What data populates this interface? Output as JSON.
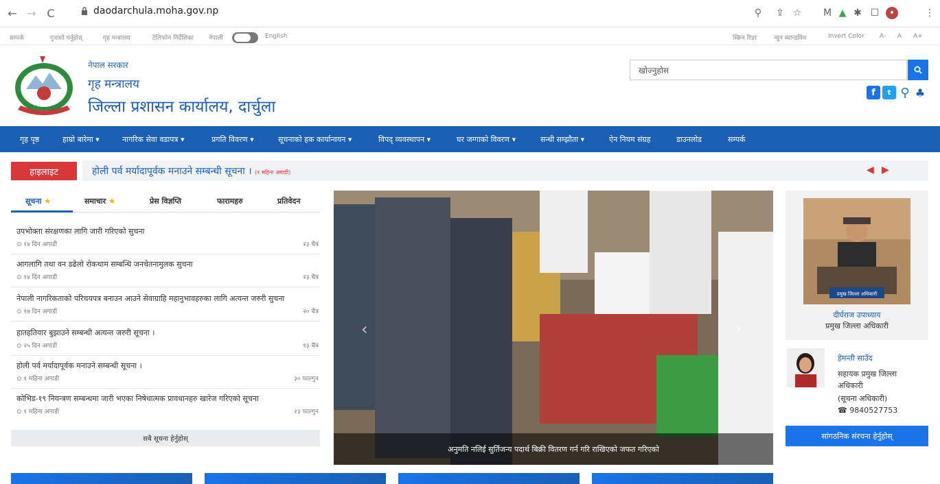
{
  "browser": {
    "url": "daodarchula.moha.gov.np"
  },
  "utility": {
    "left": [
      "सम्पर्क",
      "गुनासो गर्नुहोस्",
      "गृह मन्त्रालय",
      "टेलिफोन निर्देशिका",
      "नेपाली",
      "English"
    ],
    "right": [
      "स्क्रिन रिडर",
      "न्यून ब्यान्डविथ",
      "Invert Color",
      "A-",
      "A",
      "A+"
    ]
  },
  "header": {
    "gov": "नेपाल सरकार",
    "ministry": "गृह मन्त्रालय",
    "office": "जिल्ला प्रशासन कार्यालय, दार्चुला",
    "search_placeholder": "खोज्नुहोस"
  },
  "nav": [
    "गृह पृष्ठ",
    "हाम्रो बारेमा ▾",
    "नागरिक सेवा वडापत्र ▾",
    "प्रगति विवरण ▾",
    "सूचनाको हक कार्यान्वयन ▾",
    "विपद् व्यवस्थापन ▾",
    "घर जग्गाको विवरण ▾",
    "सन्धी सम्झौता ▾",
    "ऐन नियम संग्रह",
    "डाउनलोड",
    "सम्पर्क"
  ],
  "highlight": {
    "label": "हाइलाइट",
    "text": "होली पर्व मर्यादापूर्वक मनाउने सम्बन्धी सूचना ।",
    "time": "(१ महिना अगाडी)"
  },
  "tabs": [
    "सूचना",
    "समाचार",
    "प्रेस विज्ञप्ति",
    "फारामहरु",
    "प्रतिवेदन"
  ],
  "notices": [
    {
      "title": "उपभोक्ता संरक्षणका लागि जारी गरिएको सुचना",
      "ago": "१४ दिन अगाडी",
      "date": "२३ चैत्र"
    },
    {
      "title": "आगलागि तथा वन डढेलो रोकथाम सम्बन्धि जनचेतनामुलक सुचना",
      "ago": "१४ दिन अगाडी",
      "date": "२३ चैत्र"
    },
    {
      "title": "नेपाली नागरिकताको परिचयपत्र बनाउन आउने सेवाग्राहि महानुभावहरुका लागि अत्यन्त जरुरी सुचना",
      "ago": "१७ दिन अगाडी",
      "date": "२० चैत्र"
    },
    {
      "title": "हातहतियार बुझाउने सम्बन्धी अत्यन्त जरुरी सूचना ।",
      "ago": "२५ दिन अगाडी",
      "date": "१३ चैत्र"
    },
    {
      "title": "होली पर्व मर्यादापूर्वक मनाउने सम्बन्धी सूचना ।",
      "ago": "१ महिना अगाडी",
      "date": "३० फाल्गुन"
    },
    {
      "title": "कोभिड-१९ नियन्त्रण सम्बन्धमा जारी भएका निषेधात्मक प्रावधानहरु खारेज गरिएको सूचना",
      "ago": "१ महिना अगाडी",
      "date": "२३ फाल्गुन"
    }
  ],
  "all_notices": "सबै सूचना हेर्नुहोस्",
  "slider_caption": "अनुमति नलिई सुर्तिजन्य पदार्थ बिक्री वितरण गर्न गरि राखिएको जफत गरिएको",
  "cdo": {
    "name": "दीर्घराज उपाध्याय",
    "role": "प्रमुख जिल्ला अधिकारी",
    "plaque": "प्रमुख जिल्ला अधिकारी"
  },
  "ado": {
    "name": "हेमन्ती साउँद",
    "role1": "सहायक प्रमुख जिल्ला",
    "role2": "अधिकारी",
    "role3": "(सूचना अधिकारी)",
    "phone": "9840527753"
  },
  "org_btn": "सांगठनिक संरचना हेर्नुहोस्",
  "colors": {
    "primary": "#1a5fb4",
    "accent": "#d9383a"
  }
}
